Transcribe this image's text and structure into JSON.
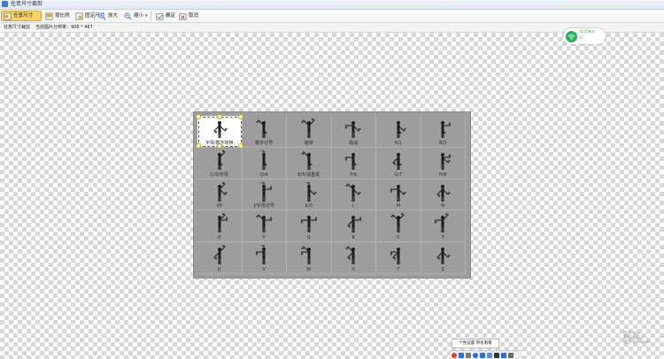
{
  "window": {
    "title": "任意尺寸裁剪"
  },
  "toolbar": {
    "buttons": [
      {
        "label": "任意尺寸"
      },
      {
        "label": "按比例"
      },
      {
        "label": "固定尺寸"
      },
      {
        "label": "放大"
      },
      {
        "label": "缩小"
      },
      {
        "label": "确定"
      },
      {
        "label": "取消"
      }
    ]
  },
  "status": {
    "mode": "任意尺寸裁剪",
    "resolution": "当前图片分辨率：908 * 467"
  },
  "flags": {
    "cells": [
      "字母/数字转换",
      "数字记号",
      "错误",
      "取消",
      "A/1",
      "B/2",
      "C/3/字母",
      "D/4",
      "E/5/请重发",
      "F/6",
      "G/7",
      "H/8",
      "I/9",
      "J/字母记号",
      "K/0",
      "L",
      "M",
      "N",
      "O",
      "P",
      "Q",
      "R",
      "S",
      "T",
      "U",
      "V",
      "W",
      "X",
      "Y",
      "Z"
    ]
  },
  "network": {
    "up": "0.05K/s",
    "down": "0"
  },
  "tray": {
    "popup": "个性设置   所有看看"
  },
  "watermark": {
    "lines": [
      "激活 Win",
      "转到设置以",
      "激活 Windows"
    ]
  },
  "colors": {
    "accent": "#f6d36a",
    "wifi": "#27b35a",
    "panel": "#9d9d9d"
  }
}
